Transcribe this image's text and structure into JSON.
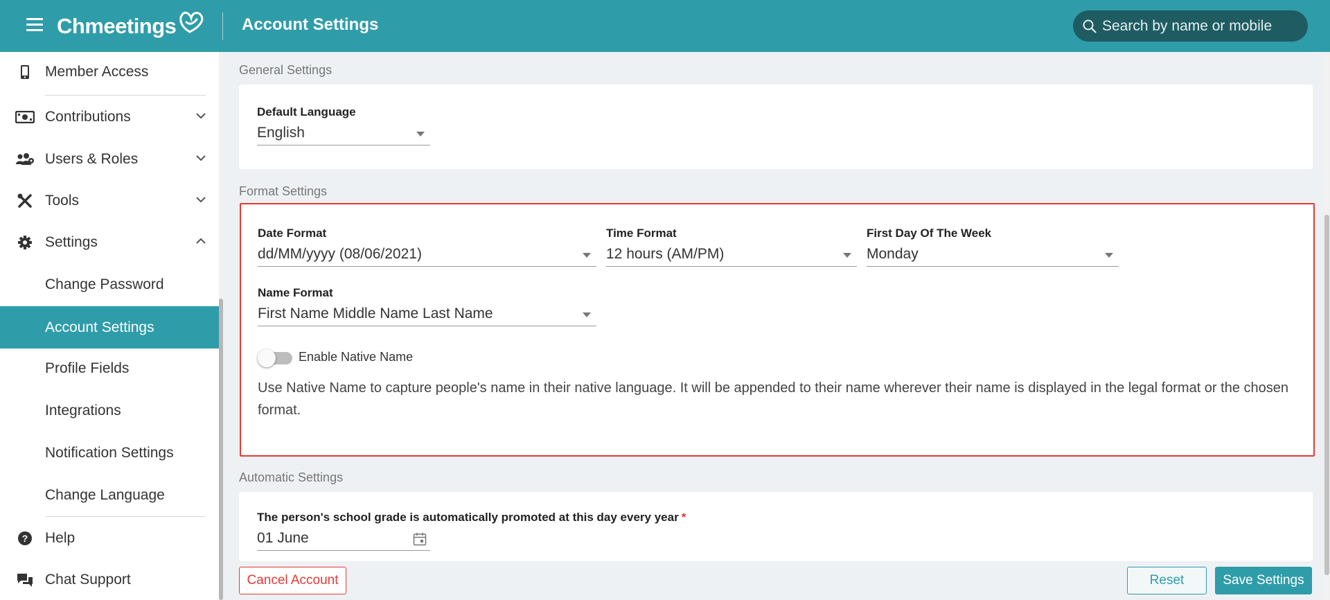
{
  "header": {
    "logo_text": "Chmeetings",
    "page_title": "Account Settings",
    "search_placeholder": "Search by name or mobile"
  },
  "sidebar": {
    "items": [
      {
        "label": "Member Access",
        "icon": "mobile-icon"
      },
      {
        "label": "Contributions",
        "icon": "money-icon",
        "expandable": true,
        "expanded": false
      },
      {
        "label": "Users & Roles",
        "icon": "users-icon",
        "expandable": true,
        "expanded": false
      },
      {
        "label": "Tools",
        "icon": "tools-icon",
        "expandable": true,
        "expanded": false
      },
      {
        "label": "Settings",
        "icon": "gear-icon",
        "expandable": true,
        "expanded": true
      }
    ],
    "settings_subitems": [
      {
        "label": "Change Password",
        "active": false
      },
      {
        "label": "Account Settings",
        "active": true
      },
      {
        "label": "Profile Fields",
        "active": false
      },
      {
        "label": "Integrations",
        "active": false
      },
      {
        "label": "Notification Settings",
        "active": false
      },
      {
        "label": "Change Language",
        "active": false
      }
    ],
    "footer_items": [
      {
        "label": "Help",
        "icon": "question-icon"
      },
      {
        "label": "Chat Support",
        "icon": "chat-icon"
      }
    ]
  },
  "general_settings": {
    "title": "General Settings",
    "default_language": {
      "label": "Default Language",
      "value": "English"
    }
  },
  "format_settings": {
    "title": "Format Settings",
    "date_format": {
      "label": "Date Format",
      "value": "dd/MM/yyyy (08/06/2021)"
    },
    "time_format": {
      "label": "Time Format",
      "value": "12 hours (AM/PM)"
    },
    "first_day": {
      "label": "First Day Of The Week",
      "value": "Monday"
    },
    "name_format": {
      "label": "Name Format",
      "value": "First Name Middle Name Last Name"
    },
    "native_name": {
      "label": "Enable Native Name",
      "enabled": false
    },
    "native_name_help": "Use Native Name to capture people's name in their native language. It will be appended to their name wherever their name is displayed in the legal format or the chosen format."
  },
  "automatic_settings": {
    "title": "Automatic Settings",
    "grade_promotion": {
      "label": "The person's school grade is automatically promoted at this day every year",
      "required_mark": "*",
      "value": "01 June"
    }
  },
  "actions": {
    "cancel_account": "Cancel Account",
    "reset": "Reset",
    "save": "Save Settings"
  },
  "colors": {
    "brand": "#2f9ca9",
    "danger": "#e53935"
  }
}
